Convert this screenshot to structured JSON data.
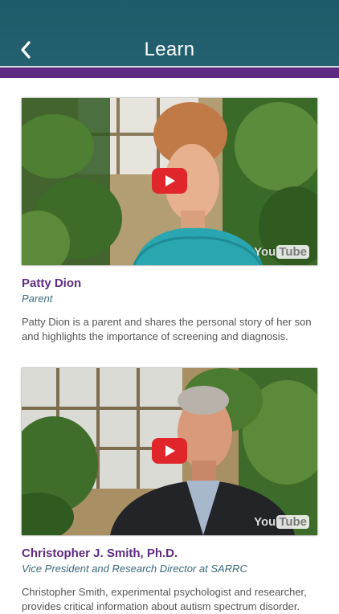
{
  "header": {
    "title": "Learn",
    "back_icon": "chevron-left-icon"
  },
  "colors": {
    "header_bg": "#24606f",
    "accent_bar": "#5e2a82",
    "name_text": "#5e2a82",
    "role_text": "#3a6a80",
    "play_button": "#e0262b"
  },
  "videos": [
    {
      "name": "Patty Dion",
      "role": "Parent",
      "description": "Patty Dion is a parent and shares the personal story of her son and highlights the importance of screening and diagnosis.",
      "watermark_a": "You",
      "watermark_b": "Tube"
    },
    {
      "name": "Christopher J. Smith, Ph.D.",
      "role": "Vice President and Research Director at SARRC",
      "description": "Christopher Smith, experimental psychologist and researcher, provides critical information about autism spectrum disorder.",
      "watermark_a": "You",
      "watermark_b": "Tube"
    }
  ]
}
